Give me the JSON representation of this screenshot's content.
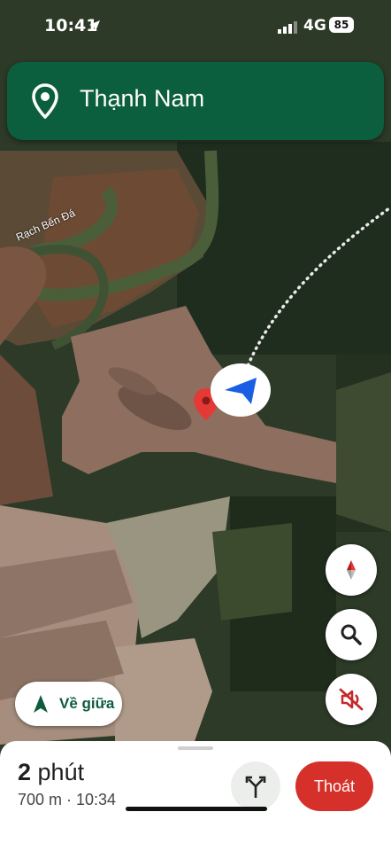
{
  "status_bar": {
    "time": "10:41",
    "carrier": "4G",
    "battery": "85"
  },
  "header": {
    "destination": "Thạnh Nam"
  },
  "map": {
    "river_label": "Rạch Bến Đá"
  },
  "recenter": {
    "label": "Về giữa"
  },
  "trip": {
    "eta_number": "2",
    "eta_unit": " phút",
    "details": "700 m · 10:34"
  },
  "actions": {
    "exit_label": "Thoát"
  },
  "colors": {
    "header_green": "#0b5e3e",
    "exit_red": "#d6302a",
    "nav_blue": "#1a5fe3"
  }
}
